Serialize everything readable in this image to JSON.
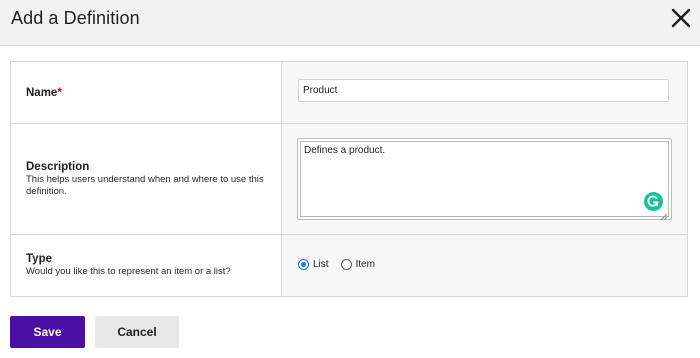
{
  "dialog": {
    "title": "Add a Definition"
  },
  "form": {
    "name": {
      "label": "Name",
      "required_mark": "*",
      "value": "Product"
    },
    "description": {
      "label": "Description",
      "help": "This helps users understand when and where to use this definition.",
      "value": "Defines a product."
    },
    "type": {
      "label": "Type",
      "help": "Would you like this to represent an item or a list?",
      "options": [
        {
          "label": "List",
          "checked": true
        },
        {
          "label": "Item",
          "checked": false
        }
      ]
    }
  },
  "buttons": {
    "save": "Save",
    "cancel": "Cancel"
  },
  "icons": {
    "close": "close-icon",
    "grammarly": "grammarly-icon",
    "resize": "resize-grip-icon"
  },
  "colors": {
    "primary": "#4b0fa5",
    "radio_accent": "#1a73e8",
    "required": "#d0021b",
    "grammarly": "#15c39a"
  }
}
